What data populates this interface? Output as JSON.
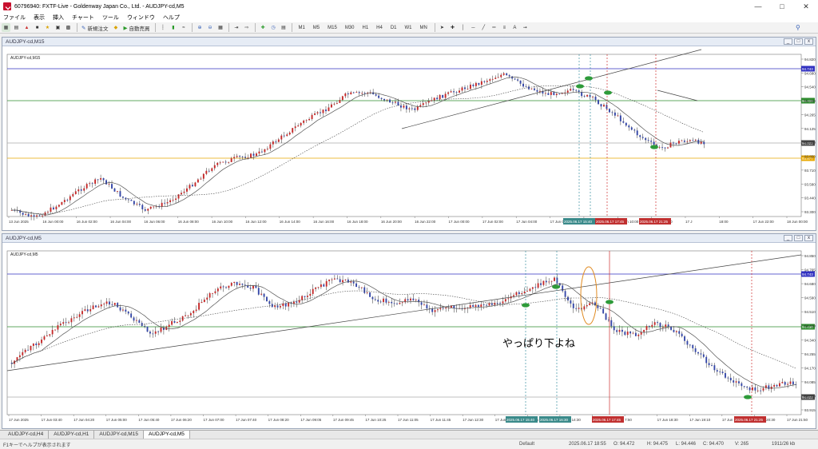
{
  "window": {
    "title": "60796940: FXTF-Live - Goldenway Japan Co., Ltd. - AUDJPY-cd,M5"
  },
  "menu": [
    "ファイル",
    "表示",
    "挿入",
    "チャート",
    "ツール",
    "ウィンドウ",
    "ヘルプ"
  ],
  "toolbar": {
    "new_order": "新規注文",
    "auto_trade": "自動売買",
    "timeframes": [
      "M1",
      "M5",
      "M15",
      "M30",
      "H1",
      "H4",
      "D1",
      "W1",
      "MN"
    ]
  },
  "chart_top": {
    "window_title": "AUDJPY-cd,M15",
    "label": "AUDJPY-cd,M15",
    "price_ticks": [
      "94.820",
      "94.680",
      "94.540",
      "94.400",
      "94.265",
      "94.125",
      "93.990",
      "93.850",
      "93.710",
      "93.580",
      "93.440",
      "93.300"
    ],
    "hline_labels": {
      "blue": "94.743",
      "green": "94.430",
      "gray": "94.022",
      "orange": "93.877"
    },
    "time_labels": [
      "13 Jun 2025",
      "16 Jun 00:00",
      "16 Jun 02:00",
      "16 Jun 04:00",
      "16 Jun 06:00",
      "16 Jun 08:00",
      "16 Jun 10:00",
      "16 Jun 12:00",
      "16 Jun 14:00",
      "16 Jun 16:00",
      "16 Jun 18:00",
      "16 Jun 20:00",
      "16 Jun 22:00",
      "17 Jun 00:00",
      "17 Jun 02:00",
      "17 Jun 04:00",
      "17 Jun 06:00",
      "17 Jun 08:00",
      "17 Jun 10:00",
      "17 Jun 12:00",
      "17 J",
      "18:00",
      "17 Jun 22:00",
      "18 Jun 00:00"
    ],
    "marker_labels": [
      "2025.06.17 15:40",
      "2025.06.17 17:45",
      "2025.06.17 21:25"
    ]
  },
  "chart_bottom": {
    "window_title": "AUDJPY-cd,M5",
    "label": "AUDJPY-cd,M5",
    "annotation": "やっぱり下よね",
    "price_ticks": [
      "94.850",
      "94.765",
      "94.680",
      "94.590",
      "94.510",
      "94.430",
      "94.340",
      "94.255",
      "94.170",
      "94.085",
      "94.000",
      "93.915"
    ],
    "hline_labels": {
      "blue": "94.743",
      "green": "94.430",
      "gray": "94.022"
    },
    "time_labels": [
      "17 Jun 2025",
      "17 Jun 03:40",
      "17 Jun 04:20",
      "17 Jun 05:00",
      "17 Jun 05:40",
      "17 Jun 06:20",
      "17 Jun 07:00",
      "17 Jun 07:40",
      "17 Jun 08:20",
      "17 Jun 09:05",
      "17 Jun 09:45",
      "17 Jun 10:25",
      "17 Jun 11:05",
      "17 Jun 11:45",
      "17 Jun 12:30",
      "17 Jun 13:10",
      "17 Jun 13:50",
      "17 Jun 14:30",
      "17 J",
      "7:50",
      "17 Jun 18:30",
      "17 Jun 19:10",
      "17 Jun 19:50",
      "17 Jun 20:30",
      "17 Jun 21:50"
    ],
    "marker_labels": [
      "2025.06.17 15:40",
      "2025.06.17 16:30",
      "2025.06.17 17:45",
      "2025.06.17 21:25"
    ]
  },
  "tabs": [
    "AUDJPY-cd,H4",
    "AUDJPY-cd,H1",
    "AUDJPY-cd,M15",
    "AUDJPY-cd,M5"
  ],
  "status": {
    "help": "F1キーでヘルプが表示されます",
    "profile": "Default",
    "datetime": "2025.06.17 18:55",
    "open": "O: 94.472",
    "high": "H: 94.475",
    "low": "L: 94.446",
    "close": "C: 94.470",
    "volume": "V: 265",
    "traffic": "1911/26 kb"
  }
}
